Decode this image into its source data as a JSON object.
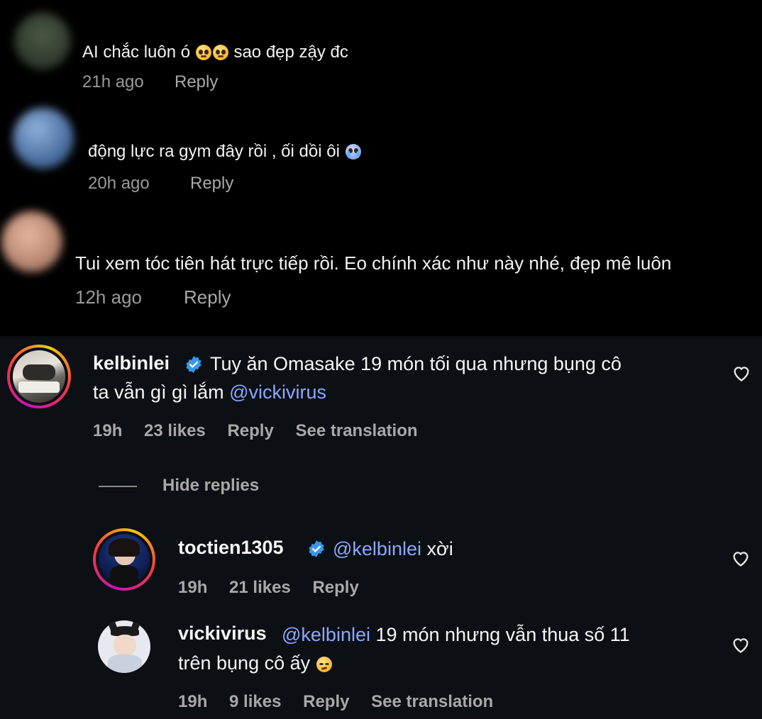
{
  "comments_top": [
    {
      "text": "AI chắc luôn ó",
      "emoji": "pleading-face-emoji",
      "text2": "sao đẹp zậy đc",
      "time": "21h ago",
      "reply": "Reply"
    },
    {
      "text": "động lực ra gym đây rồi , ối dồi ôi",
      "emoji": "crying-face-emoji",
      "time": "20h ago",
      "reply": "Reply"
    },
    {
      "text": "Tui xem tóc tiên hát trực tiếp rồi. Eo chính xác như này nhé, đẹp mê luôn",
      "time": "12h ago",
      "reply": "Reply"
    }
  ],
  "main_comment": {
    "username": "kelbinlei",
    "line1": "Tuy ăn Omasake 19 món tối qua nhưng bụng cô",
    "line2": "ta vẫn gì gì lắm",
    "mention": "@vickivirus",
    "time": "19h",
    "likes": "23 likes",
    "reply": "Reply",
    "translate": "See translation"
  },
  "hide_replies": "Hide replies",
  "replies": [
    {
      "username": "toctien1305",
      "mention": "@kelbinlei",
      "text": "xời",
      "time": "19h",
      "likes": "21 likes",
      "reply": "Reply"
    },
    {
      "username": "vickivirus",
      "mention": "@kelbinlei",
      "line1": "19 món nhưng vẫn thua số 11",
      "line2": "trên bụng cô ấy",
      "emoji": "smirking-face-emoji",
      "time": "19h",
      "likes": "9 likes",
      "reply": "Reply",
      "translate": "See translation"
    }
  ],
  "colors": {
    "background_top": "#000000",
    "background_bottom": "#0c0f14",
    "mention": "#8aa8ff",
    "verified": "#3797f0",
    "meta": "#a8a8a8"
  }
}
